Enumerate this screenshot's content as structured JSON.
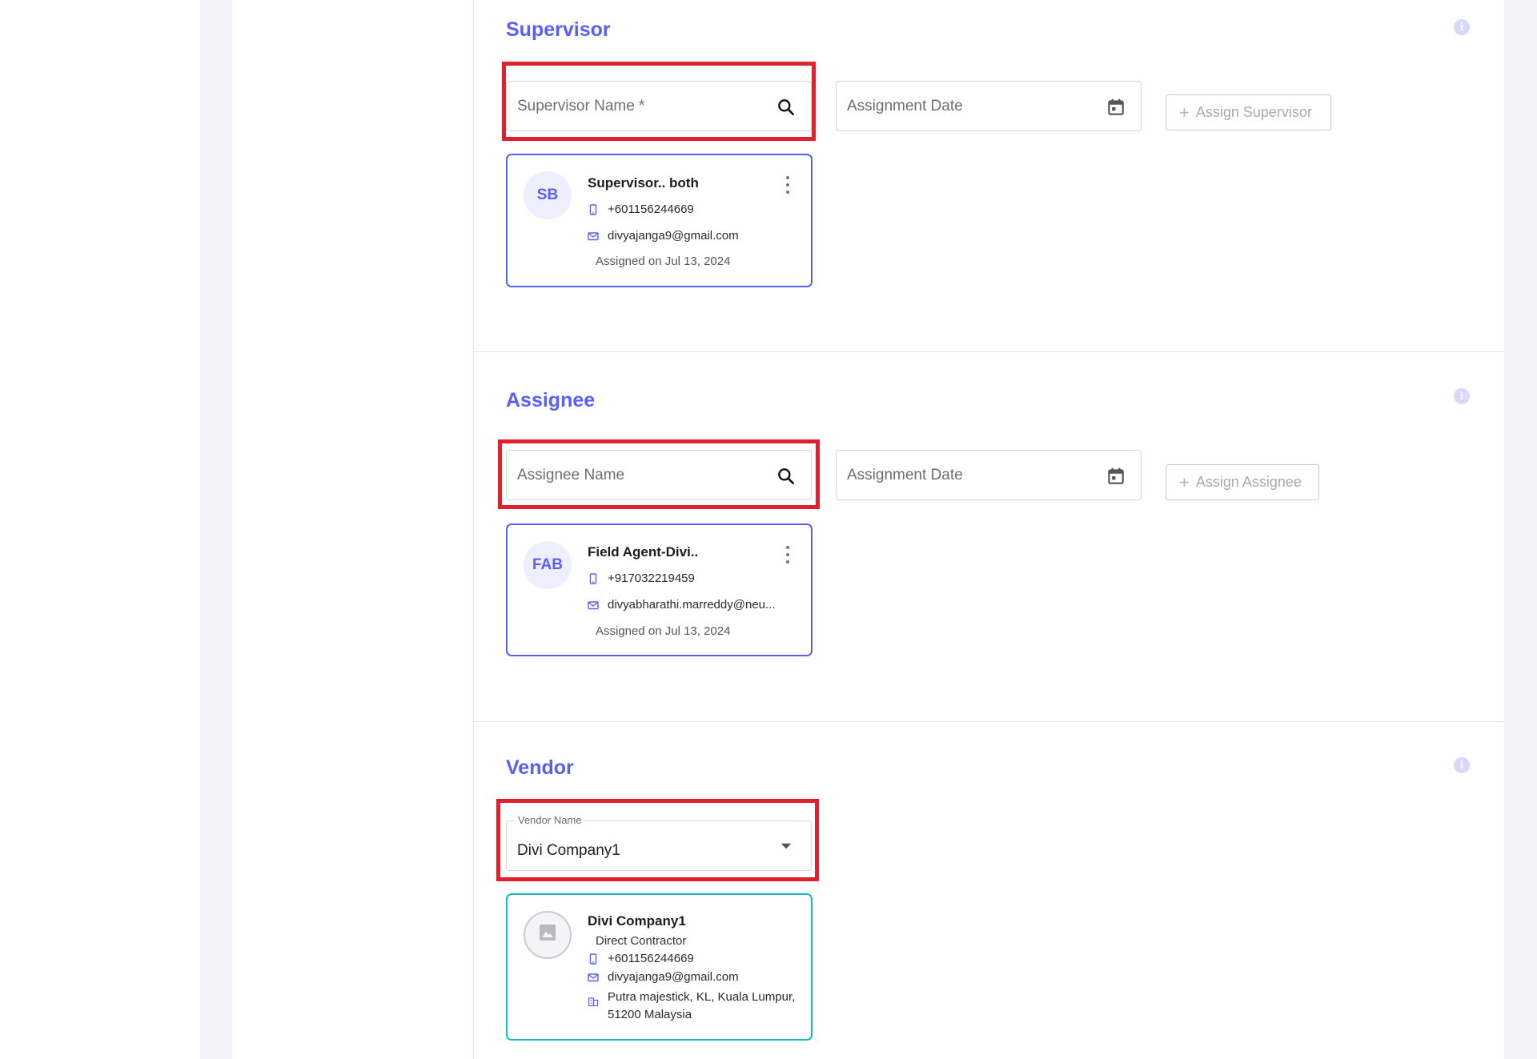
{
  "colors": {
    "accent": "#5b5ef4",
    "highlight": "#e0202a",
    "vendor_card_border": "#14bcc6"
  },
  "supervisor": {
    "title": "Supervisor",
    "name_placeholder": "Supervisor Name *",
    "date_placeholder": "Assignment Date",
    "assign_button": "Assign Supervisor",
    "card": {
      "initials": "SB",
      "name": "Supervisor.. both",
      "phone": "+601156244669",
      "email": "divyajanga9@gmail.com",
      "assigned": "Assigned on Jul 13, 2024"
    }
  },
  "assignee": {
    "title": "Assignee",
    "name_placeholder": "Assignee Name",
    "date_placeholder": "Assignment Date",
    "assign_button": "Assign Assignee",
    "card": {
      "initials": "FAB",
      "name": "Field Agent-Divi..",
      "phone": "+917032219459",
      "email": "divyabharathi.marreddy@neu...",
      "assigned": "Assigned on Jul 13, 2024"
    }
  },
  "vendor": {
    "title": "Vendor",
    "field_label": "Vendor Name",
    "selected": "Divi Company1",
    "card": {
      "name": "Divi Company1",
      "type": "Direct Contractor",
      "phone": "+601156244669",
      "email": "divyajanga9@gmail.com",
      "address_line1": "Putra majestick, KL, Kuala Lumpur,",
      "address_line2": "51200 Malaysia"
    }
  },
  "icons": {
    "info": "info-icon",
    "search": "search-icon",
    "calendar": "calendar-icon",
    "phone": "phone-icon",
    "email": "email-icon",
    "building": "building-icon",
    "more": "more-vertical-icon",
    "dropdown": "caret-down-icon",
    "image": "image-placeholder-icon"
  }
}
